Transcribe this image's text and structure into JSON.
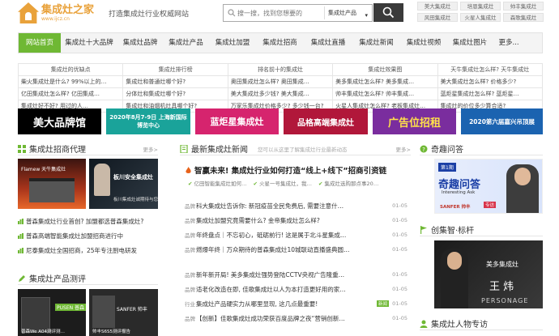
{
  "header": {
    "logo_name": "集成灶之家",
    "logo_url": "www.ijcz.cn",
    "slogan": "打造集成灶行业权威网站",
    "search_placeholder": "搜一搜，找到您想要的",
    "search_category": "集成灶产品",
    "quick_links": [
      "美大集成灶",
      "培恩集成灶",
      "帅丰集成灶",
      "风田集成灶",
      "火星人集成灶",
      "森歌集成灶"
    ]
  },
  "nav": {
    "items": [
      "网站首页",
      "集成灶十大品牌",
      "集成灶品牌",
      "集成灶产品",
      "集成灶加盟",
      "集成灶招商",
      "集成灶直播",
      "集成灶新闻",
      "集成灶视频",
      "集成灶图片",
      "更多..."
    ]
  },
  "keywords": {
    "rows": [
      [
        "集成灶的优缺点",
        "集成灶排行榜",
        "排名前十的集成灶",
        "集成灶效果图",
        "天牛集成灶怎么样? 天牛集成灶"
      ],
      [
        "柴火集成灶是什么? 99%以上的…",
        "集成灶和普通灶哪个好?",
        "奥田集成灶怎么样? 奥田集成…",
        "美多集成灶怎么样? 美多集成…",
        "美大集成灶怎么样? 价格多少?"
      ],
      [
        "亿田集成灶怎么样? 亿田集成…",
        "分体灶和集成灶哪个好?",
        "美大集成灶多少钱? 美大集成…",
        "帅丰集成灶怎么样? 帅丰集成…",
        "蓝炬星集成灶怎么样? 蓝炬星…"
      ],
      [
        "集成灶好不好? 用过的人…",
        "集成灶和油烟机灶具哪个好?",
        "万家乐集成灶价格多少? 多少钱一台?",
        "火星人集成灶怎么样? 老板集成灶…",
        "集成灶的价位多少算合适?"
      ]
    ]
  },
  "banners": [
    {
      "text": "美大品牌馆",
      "color": "#000000"
    },
    {
      "text": "2020年8月7-9日 上海新国际博览中心",
      "color": "#1aa39a"
    },
    {
      "text": "蓝炬星集成灶",
      "color": "#d6246e"
    },
    {
      "text": "品格高端集成灶",
      "color": "#b1173a"
    },
    {
      "text": "广告位招租",
      "color": "#7a2d9e"
    },
    {
      "text": "2020第六届嘉兴吊顶展",
      "color": "#1b63b0"
    }
  ],
  "left": {
    "recruit_title": "集成灶招商代理",
    "more": "更多>",
    "img1_caption": "Flamew 天牛集成灶",
    "img2_caption": "板川安全集成灶",
    "img2_sub": "板川集成灶诚期待与您…",
    "links": [
      "普森集成灶行业首创? 加盟都选普森集成灶?",
      "普森高端智能集成灶加盟招商进行中",
      "尼泰集成灶全国招商，25年专注厨电研发"
    ],
    "eval_title": "集成灶产品测评",
    "eval_img1": "PUSEN 普森",
    "eval_img1_sub": "普森We A04测评测…",
    "eval_img2": "SANFER 帅丰",
    "eval_img2_sub": "帅丰S6S5测评报告"
  },
  "center": {
    "news_title": "最新集成灶新闻",
    "news_sub": "您可以从这里了解集成灶行业最新动态",
    "more": "更多>",
    "headline": "智赢未来! 集成灶行业如何打造“线上+线下”招商引资链",
    "headline_subs": [
      "亿田智能集成灶如何…",
      "火星一号集成灶，我…",
      "集成灶选购那点事20…"
    ],
    "news": [
      {
        "tag": "品牌",
        "title": "科大集成灶告诉你: 新冠疫苗全民免费后, 需要注意什…",
        "date": "01-05"
      },
      {
        "tag": "品牌",
        "title": "集成灶加盟究竟需要什么? 金帝集成灶怎么样?",
        "date": "01-05"
      },
      {
        "tag": "品牌",
        "title": "年终盘点｜不忘初心，砥砺前行! 这是属于北斗星集成…",
        "date": "01-05"
      },
      {
        "tag": "品牌",
        "title": "燃爆年终｜万众期待的普森集成灶10城联动直播盛典圆…",
        "date": "01-05"
      },
      {
        "tag": "品牌",
        "title": "新年新开局! 美多集成灶强势登陆CCTV央视广告隆重…",
        "date": "01-05"
      },
      {
        "tag": "品牌",
        "title": "适老化改造在即, 佳歌集成灶以人为本打造更好用的家…",
        "date": "01-05"
      },
      {
        "tag": "行业",
        "title": "集成灶产品硬实力从哪里显现, 这几点最重要!",
        "date": "01-05",
        "badge": "新闻"
      },
      {
        "tag": "品牌",
        "title": "【创新】佳歌集成灶成功荣获百度品牌之夜“营销创新…",
        "date": "01-05"
      }
    ]
  },
  "right": {
    "qa_title": "奇趣问答",
    "qa_banner_top": "第1期",
    "qa_banner_main": "奇趣问答",
    "qa_banner_en": "Interesting Ask",
    "qa_banner_brand": "SANFER 帅丰",
    "qa_banner_badge": "专访",
    "person_title": "创集智·标杆",
    "person_brand": "美多集成灶",
    "person_name": "王 炜",
    "person_en": "PERSONAGE",
    "people_title": "集成灶人物专访"
  }
}
